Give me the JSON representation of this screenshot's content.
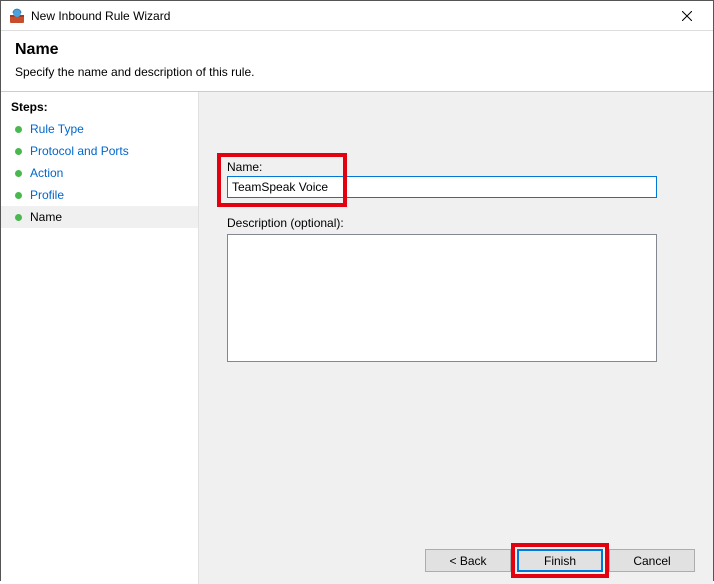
{
  "window": {
    "title": "New Inbound Rule Wizard"
  },
  "header": {
    "title": "Name",
    "subtitle": "Specify the name and description of this rule."
  },
  "sidebar": {
    "heading": "Steps:",
    "items": [
      {
        "label": "Rule Type"
      },
      {
        "label": "Protocol and Ports"
      },
      {
        "label": "Action"
      },
      {
        "label": "Profile"
      },
      {
        "label": "Name"
      }
    ]
  },
  "form": {
    "name_label": "Name:",
    "name_value": "TeamSpeak Voice",
    "desc_label": "Description (optional):",
    "desc_value": ""
  },
  "buttons": {
    "back": "< Back",
    "finish": "Finish",
    "cancel": "Cancel"
  }
}
